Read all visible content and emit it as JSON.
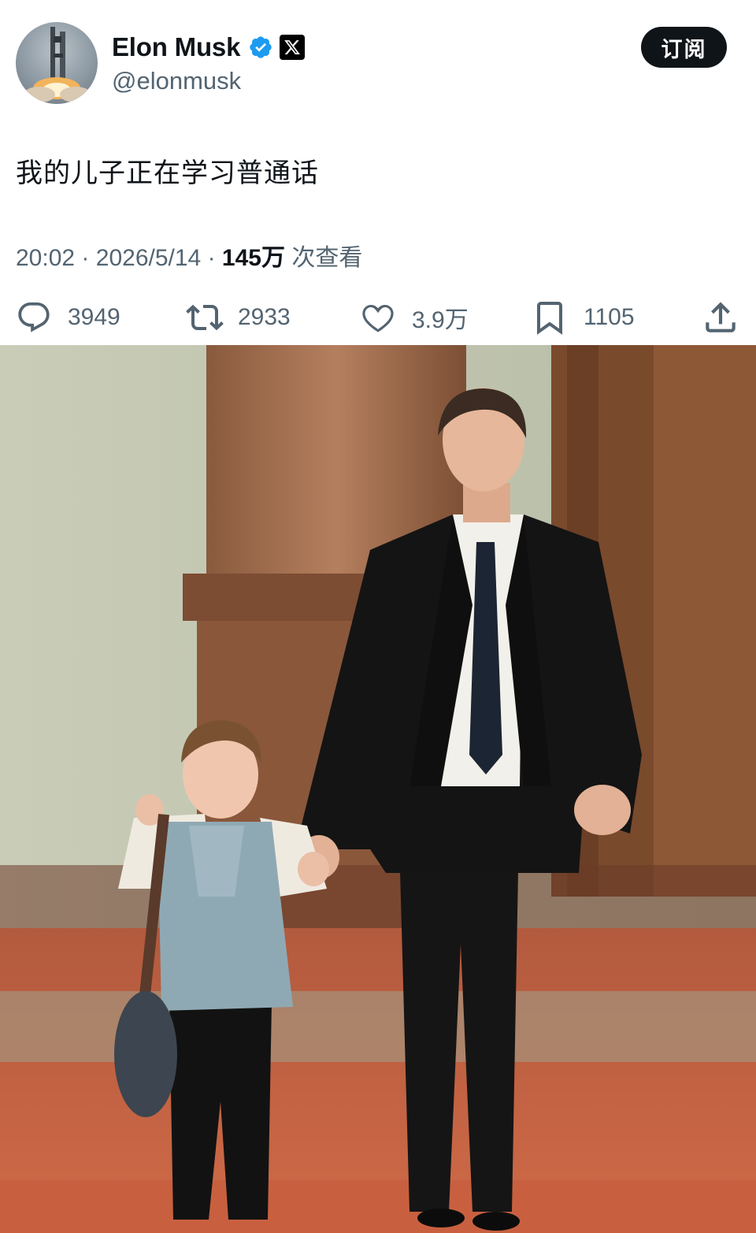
{
  "user": {
    "display_name": "Elon Musk",
    "handle": "@elonmusk",
    "verified": true,
    "avatar_icon": "rocket-launch-avatar",
    "affiliation_icon": "x-logo-icon"
  },
  "subscribe_label": "订阅",
  "tweet": {
    "text": "我的儿子正在学习普通话",
    "time": "20:02",
    "separator": "·",
    "date": "2026/5/14",
    "views": "145万",
    "views_label": "次查看"
  },
  "actions": {
    "replies": "3949",
    "reposts": "2933",
    "likes": "3.9万",
    "bookmarks": "1105"
  },
  "colors": {
    "text": "#0f1419",
    "muted": "#536471",
    "verified": "#1d9bf0",
    "button": "#0f1419"
  },
  "media": {
    "type": "photo",
    "icon": "photo-man-and-child-walking"
  }
}
